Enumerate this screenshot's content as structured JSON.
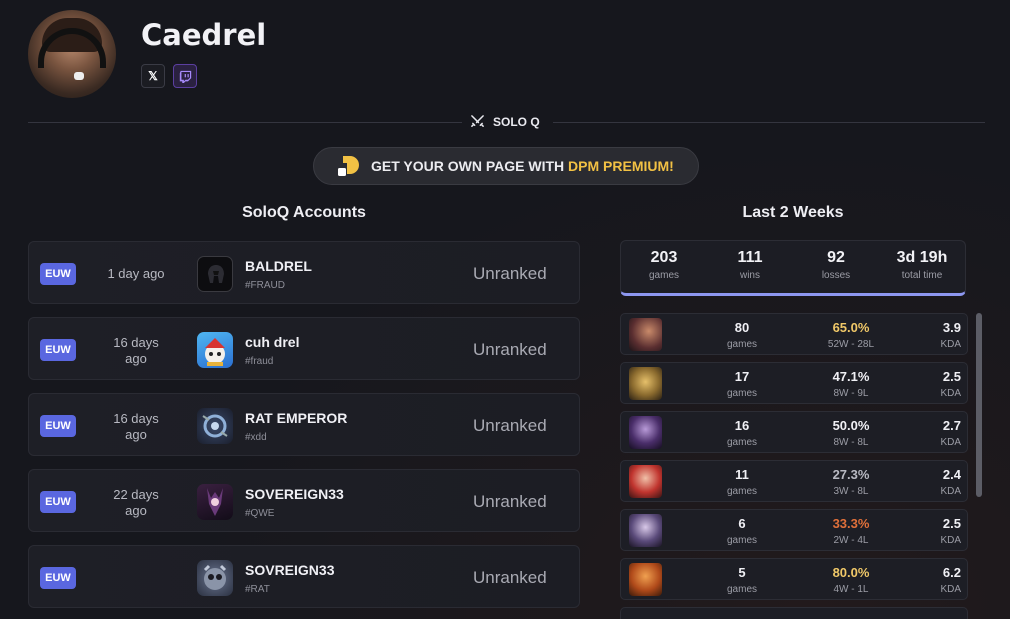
{
  "profile": {
    "name": "Caedrel",
    "social": {
      "x_icon": "x-twitter-icon",
      "twitch_icon": "twitch-icon"
    }
  },
  "section": {
    "label": "SOLO Q",
    "icon": "crossed-swords-icon"
  },
  "premium": {
    "text_before": "GET YOUR OWN PAGE WITH ",
    "text_accent": "DPM PREMIUM!",
    "accent_color": "#f2c144"
  },
  "accounts": {
    "title": "SoloQ Accounts",
    "rows": [
      {
        "region": "EUW",
        "time": "1 day ago",
        "name": "BALDREL",
        "tag": "#FRAUD",
        "rank": "Unranked"
      },
      {
        "region": "EUW",
        "time": "16 days ago",
        "name": "cuh drel",
        "tag": "#fraud",
        "rank": "Unranked"
      },
      {
        "region": "EUW",
        "time": "16 days ago",
        "name": "RAT EMPEROR",
        "tag": "#xdd",
        "rank": "Unranked"
      },
      {
        "region": "EUW",
        "time": "22 days ago",
        "name": "SOVEREIGN33",
        "tag": "#QWE",
        "rank": "Unranked"
      },
      {
        "region": "EUW",
        "time": "",
        "name": "SOVREIGN33",
        "tag": "#RAT",
        "rank": "Unranked"
      }
    ]
  },
  "last_weeks": {
    "title": "Last 2 Weeks",
    "summary": [
      {
        "value": "203",
        "label": "games"
      },
      {
        "value": "111",
        "label": "wins"
      },
      {
        "value": "92",
        "label": "losses"
      },
      {
        "value": "3d 19h",
        "label": "total time"
      }
    ],
    "champions": [
      {
        "games": "80",
        "games_label": "games",
        "winrate": "65.0%",
        "record": "52W - 28L",
        "kda": "3.9",
        "kda_label": "KDA",
        "wr_color": "#f0c868"
      },
      {
        "games": "17",
        "games_label": "games",
        "winrate": "47.1%",
        "record": "8W - 9L",
        "kda": "2.5",
        "kda_label": "KDA",
        "wr_color": "#f0f0f5"
      },
      {
        "games": "16",
        "games_label": "games",
        "winrate": "50.0%",
        "record": "8W - 8L",
        "kda": "2.7",
        "kda_label": "KDA",
        "wr_color": "#f0f0f5"
      },
      {
        "games": "11",
        "games_label": "games",
        "winrate": "27.3%",
        "record": "3W - 8L",
        "kda": "2.4",
        "kda_label": "KDA",
        "wr_color": "#b8b9c2"
      },
      {
        "games": "6",
        "games_label": "games",
        "winrate": "33.3%",
        "record": "2W - 4L",
        "kda": "2.5",
        "kda_label": "KDA",
        "wr_color": "#e0703a"
      },
      {
        "games": "5",
        "games_label": "games",
        "winrate": "80.0%",
        "record": "4W - 1L",
        "kda": "6.2",
        "kda_label": "KDA",
        "wr_color": "#f0c868"
      }
    ]
  }
}
